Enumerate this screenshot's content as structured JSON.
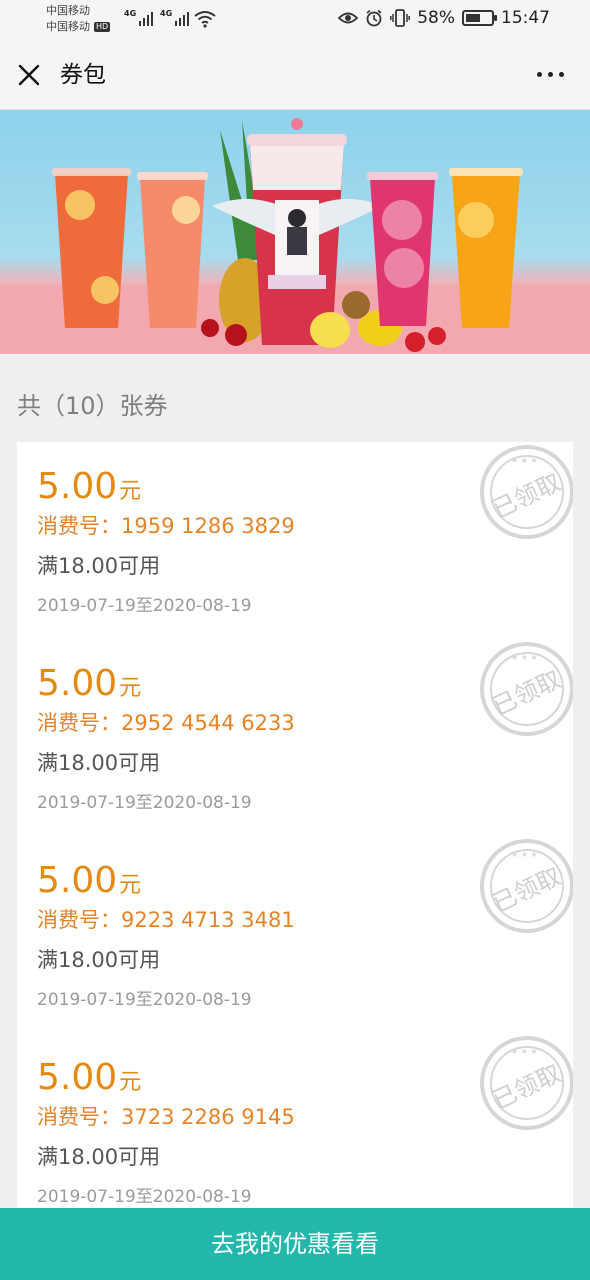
{
  "status_bar": {
    "carrier1": "中国移动",
    "carrier2": "中国移动",
    "hd": "HD",
    "network1": "4G",
    "network2": "4G",
    "battery_pct": "58%",
    "battery_level": 0.58,
    "time": "15:47"
  },
  "nav": {
    "title": "券包"
  },
  "list": {
    "count_label": "共（10）张券",
    "stamp_text": "已领取"
  },
  "coupons": [
    {
      "amount": "5.00",
      "unit": "元",
      "serial_label": "消费号：",
      "serial": "1959 1286 3829",
      "condition": "满18.00可用",
      "validity": "2019-07-19至2020-08-19"
    },
    {
      "amount": "5.00",
      "unit": "元",
      "serial_label": "消费号：",
      "serial": "2952 4544 6233",
      "condition": "满18.00可用",
      "validity": "2019-07-19至2020-08-19"
    },
    {
      "amount": "5.00",
      "unit": "元",
      "serial_label": "消费号：",
      "serial": "9223 4713 3481",
      "condition": "满18.00可用",
      "validity": "2019-07-19至2020-08-19"
    },
    {
      "amount": "5.00",
      "unit": "元",
      "serial_label": "消费号：",
      "serial": "3723 2286 9145",
      "condition": "满18.00可用",
      "validity": "2019-07-19至2020-08-19"
    }
  ],
  "bottom_button": {
    "label": "去我的优惠看看"
  },
  "colors": {
    "accent": "#23b7ac",
    "amount": "#e48a12",
    "serial": "#e58326"
  }
}
